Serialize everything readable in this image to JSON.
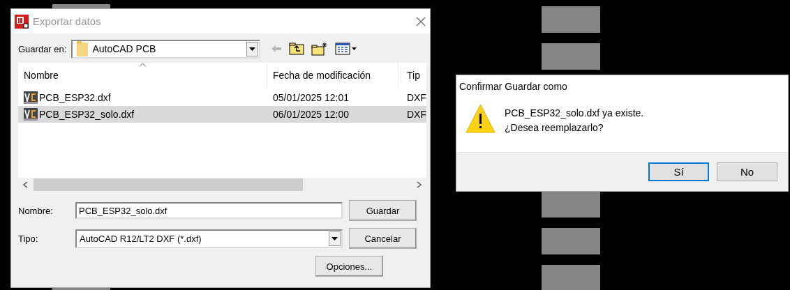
{
  "export_dialog": {
    "title": "Exportar datos",
    "save_in": {
      "label": "Guardar en:",
      "value": "AutoCAD PCB"
    },
    "columns": [
      "Nombre",
      "Fecha de modificación",
      "Tip"
    ],
    "rows": [
      {
        "name": "PCB_ESP32.dxf",
        "date": "05/01/2025 12:01",
        "type": "DXF",
        "selected": false
      },
      {
        "name": "PCB_ESP32_solo.dxf",
        "date": "06/01/2025 12:00",
        "type": "DXF",
        "selected": true
      }
    ],
    "filename": {
      "label": "Nombre:",
      "value": "PCB_ESP32_solo.dxf"
    },
    "filetype": {
      "label": "Tipo:",
      "value": "AutoCAD R12/LT2 DXF (*.dxf)"
    },
    "buttons": [
      "Guardar",
      "Cancelar",
      "Opciones..."
    ]
  },
  "confirm_dialog": {
    "title": "Confirmar Guardar como",
    "message": [
      "PCB_ESP32_solo.dxf ya existe.",
      "¿Desea reemplazarlo?"
    ],
    "buttons": [
      {
        "label": "Sí",
        "default": true
      },
      {
        "label": "No",
        "default": false
      }
    ]
  }
}
